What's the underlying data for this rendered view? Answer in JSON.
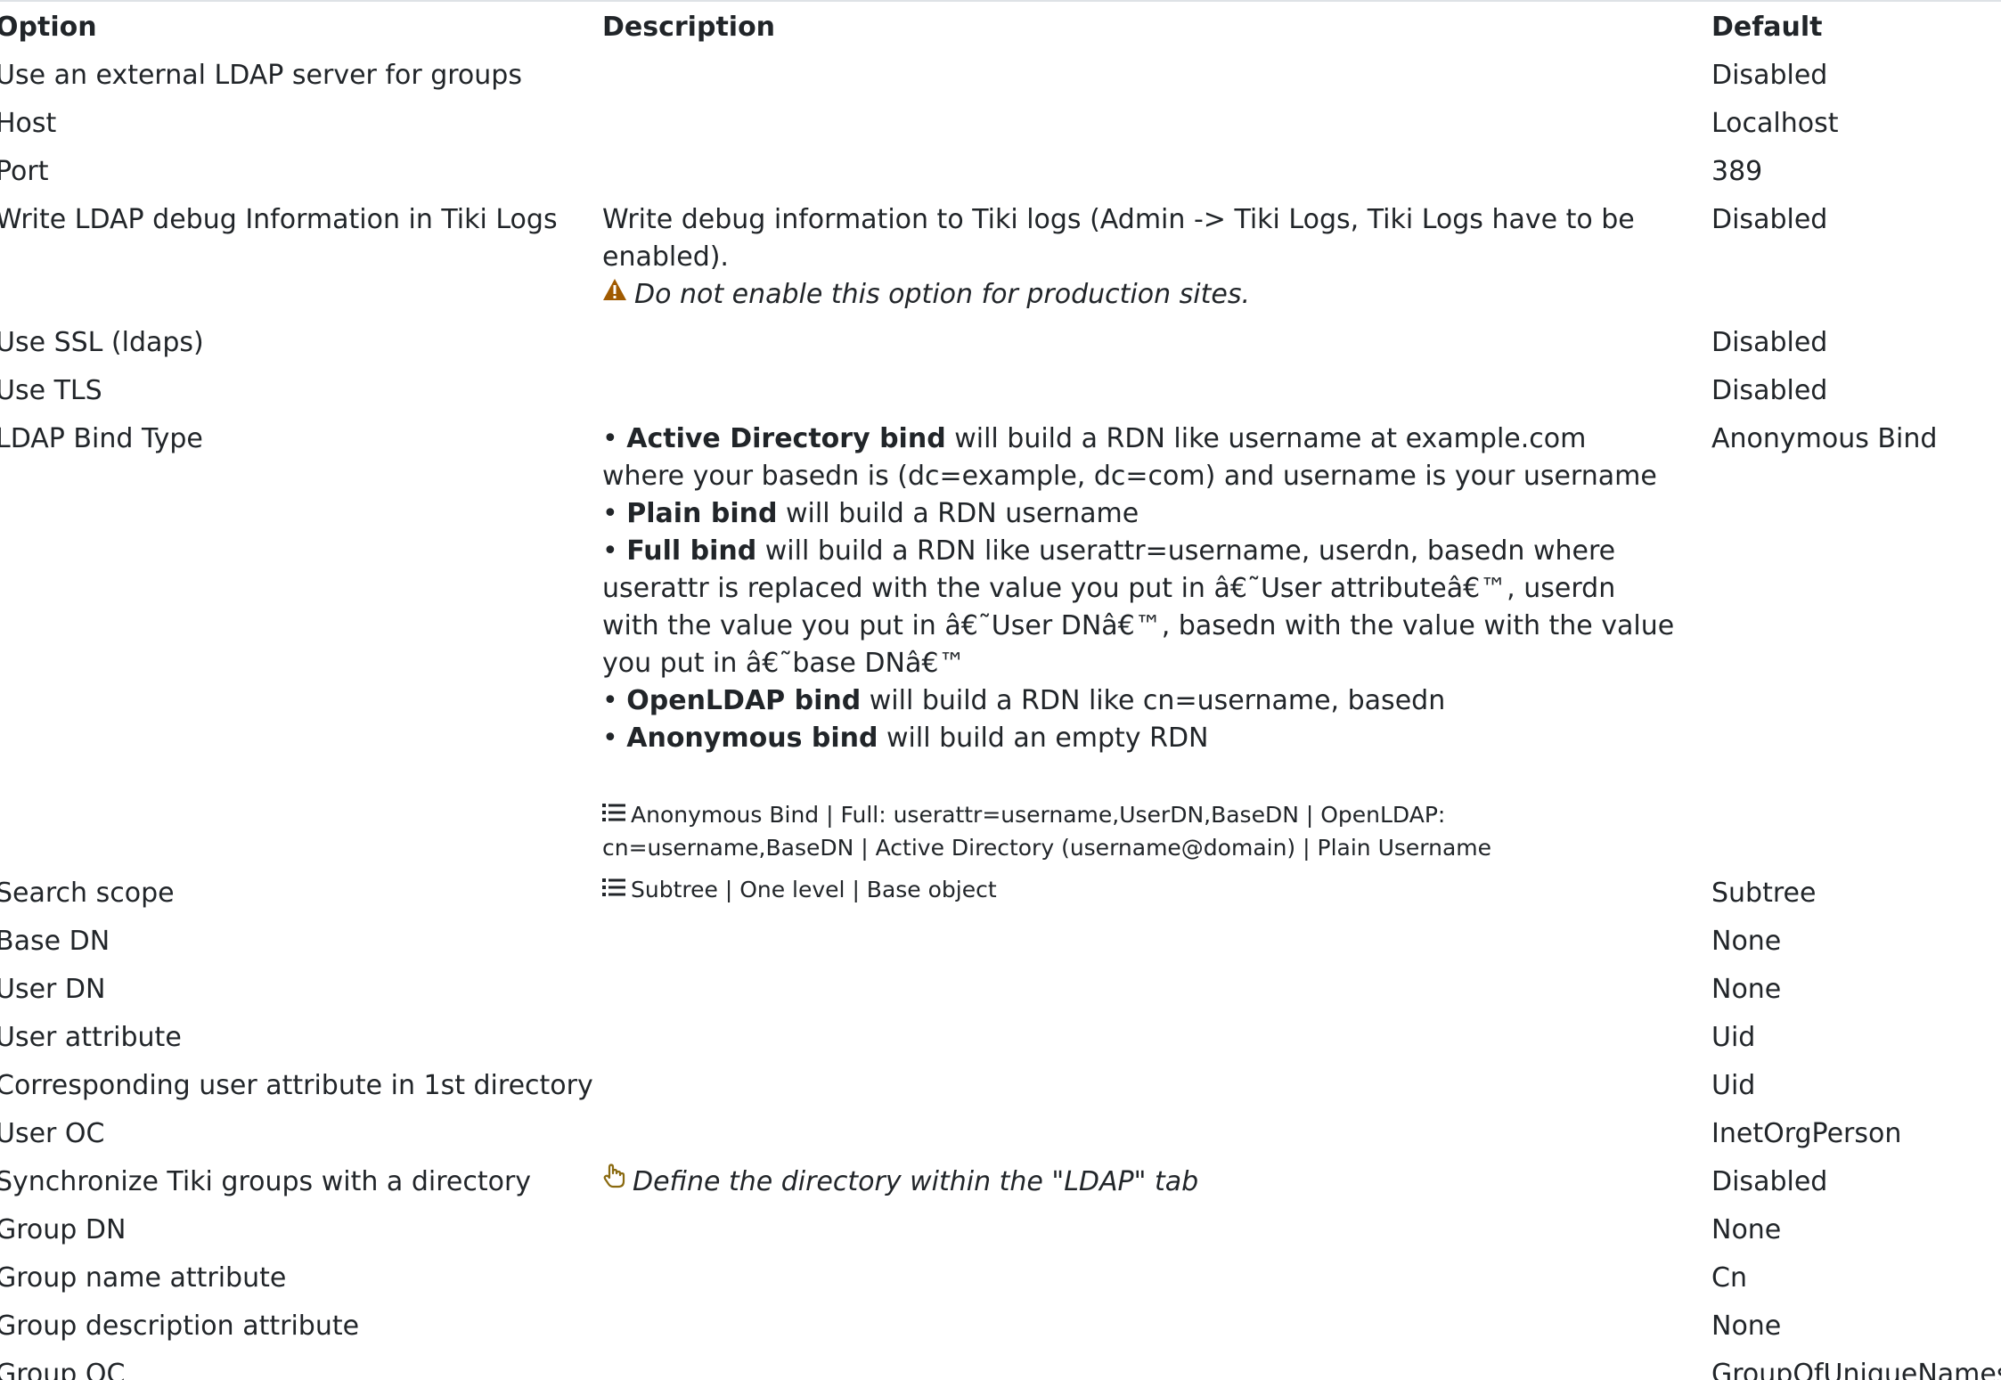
{
  "colors": {
    "text": "#212529",
    "warning_icon": "#a05a00",
    "hand_icon": "#8a6a10",
    "rule": "#dee2e6"
  },
  "headers": {
    "option": "Option",
    "description": "Description",
    "default": "Default"
  },
  "rows": [
    {
      "option": "Use an external LDAP server for groups",
      "default": "Disabled"
    },
    {
      "option": "Host",
      "default": "Localhost"
    },
    {
      "option": "Port",
      "default": "389"
    },
    {
      "option": "Write LDAP debug Information in Tiki Logs",
      "default": "Disabled",
      "description": "Write debug information to Tiki logs (Admin -> Tiki Logs, Tiki Logs have to be enabled).",
      "warning": "Do not enable this option for production sites.",
      "warning_icon": "warning-triangle-icon"
    },
    {
      "option": "Use SSL (ldaps)",
      "default": "Disabled"
    },
    {
      "option": "Use TLS",
      "default": "Disabled"
    },
    {
      "option": "LDAP Bind Type",
      "default": "Anonymous Bind",
      "bind_items": [
        {
          "name": "Active Directory bind",
          "text": " will build a RDN like username at example.com where your basedn is (dc=example, dc=com) and username is your username"
        },
        {
          "name": "Plain bind",
          "text": " will build a RDN username"
        },
        {
          "name": "Full bind",
          "text": " will build a RDN like userattr=username, userdn, basedn where userattr is replaced with the value you put in â€˜User attributeâ€™, userdn with the value you put in â€˜User DNâ€™, basedn with the value with the value you put in â€˜base DNâ€™"
        },
        {
          "name": "OpenLDAP bind",
          "text": " will build a RDN like cn=username, basedn"
        },
        {
          "name": "Anonymous bind",
          "text": " will build an empty RDN"
        }
      ],
      "bullet": "•",
      "options_icon": "list-icon",
      "options": "Anonymous Bind | Full: userattr=username,UserDN,BaseDN | OpenLDAP: cn=username,BaseDN | Active Directory (username@domain) | Plain Username"
    },
    {
      "option": "Search scope",
      "default": "Subtree",
      "options_icon": "list-icon",
      "options": "Subtree | One level | Base object"
    },
    {
      "option": "Base DN",
      "default": "None"
    },
    {
      "option": "User DN",
      "default": "None"
    },
    {
      "option": "User attribute",
      "default": "Uid"
    },
    {
      "option": "Corresponding user attribute in 1st directory",
      "default": "Uid"
    },
    {
      "option": "User OC",
      "default": "InetOrgPerson"
    },
    {
      "option": "Synchronize Tiki groups with a directory",
      "default": "Disabled",
      "hint_icon": "pointing-hand-icon",
      "hint": "Define the directory within the \"LDAP\" tab"
    },
    {
      "option": "Group DN",
      "default": "None"
    },
    {
      "option": "Group name attribute",
      "default": "Cn"
    },
    {
      "option": "Group description attribute",
      "default": "None"
    },
    {
      "option": "Group OC",
      "default": "GroupOfUniqueNames"
    }
  ]
}
